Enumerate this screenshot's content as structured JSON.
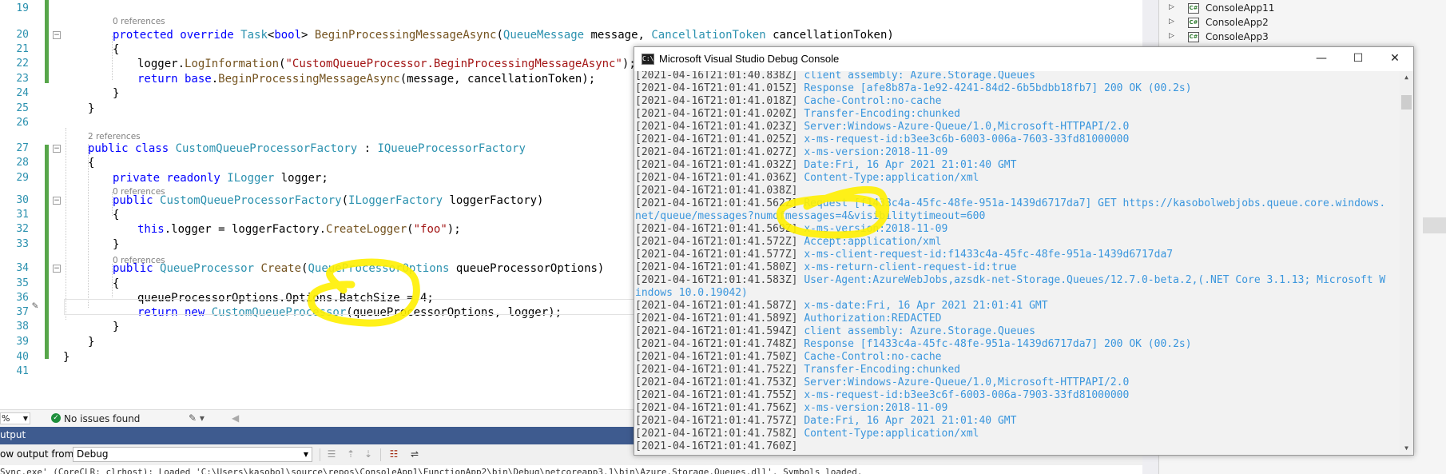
{
  "editor": {
    "code_lines": [
      {
        "num": "19",
        "parts": []
      },
      {
        "num": "20",
        "ref": "0 references",
        "parts": [
          {
            "c": "kw",
            "t": "protected override "
          },
          {
            "c": "ty",
            "t": "Task"
          },
          {
            "c": "",
            "t": "<"
          },
          {
            "c": "kw",
            "t": "bool"
          },
          {
            "c": "",
            "t": "> "
          },
          {
            "c": "mt",
            "t": "BeginProcessingMessageAsync"
          },
          {
            "c": "",
            "t": "("
          },
          {
            "c": "ty",
            "t": "QueueMessage"
          },
          {
            "c": "",
            "t": " message, "
          },
          {
            "c": "ty",
            "t": "CancellationToken"
          },
          {
            "c": "",
            "t": " cancellationToken)"
          }
        ]
      },
      {
        "num": "21",
        "parts": [
          {
            "c": "",
            "t": "{"
          }
        ]
      },
      {
        "num": "22",
        "parts": [
          {
            "c": "",
            "t": "logger."
          },
          {
            "c": "mt",
            "t": "LogInformation"
          },
          {
            "c": "",
            "t": "("
          },
          {
            "c": "st",
            "t": "\"CustomQueueProcessor.BeginProcessingMessageAsync\""
          },
          {
            "c": "",
            "t": ");"
          }
        ]
      },
      {
        "num": "23",
        "parts": [
          {
            "c": "kw",
            "t": "return base"
          },
          {
            "c": "",
            "t": "."
          },
          {
            "c": "mt",
            "t": "BeginProcessingMessageAsync"
          },
          {
            "c": "",
            "t": "(message, cancellationToken);"
          }
        ]
      },
      {
        "num": "24",
        "parts": [
          {
            "c": "",
            "t": "}"
          }
        ]
      },
      {
        "num": "25",
        "parts": [
          {
            "c": "",
            "t": "}"
          }
        ]
      },
      {
        "num": "26",
        "parts": []
      },
      {
        "num": "27",
        "ref": "2 references",
        "parts": [
          {
            "c": "kw",
            "t": "public class "
          },
          {
            "c": "ty",
            "t": "CustomQueueProcessorFactory"
          },
          {
            "c": "",
            "t": " : "
          },
          {
            "c": "ty",
            "t": "IQueueProcessorFactory"
          }
        ]
      },
      {
        "num": "28",
        "parts": [
          {
            "c": "",
            "t": "{"
          }
        ]
      },
      {
        "num": "29",
        "parts": [
          {
            "c": "kw",
            "t": "private readonly "
          },
          {
            "c": "ty",
            "t": "ILogger"
          },
          {
            "c": "",
            "t": " logger;"
          }
        ]
      },
      {
        "num": "30",
        "ref": "0 references",
        "parts": [
          {
            "c": "kw",
            "t": "public "
          },
          {
            "c": "ty",
            "t": "CustomQueueProcessorFactory"
          },
          {
            "c": "",
            "t": "("
          },
          {
            "c": "ty",
            "t": "ILoggerFactory"
          },
          {
            "c": "",
            "t": " loggerFactory)"
          }
        ]
      },
      {
        "num": "31",
        "parts": [
          {
            "c": "",
            "t": "{"
          }
        ]
      },
      {
        "num": "32",
        "parts": [
          {
            "c": "kw",
            "t": "this"
          },
          {
            "c": "",
            "t": ".logger = loggerFactory."
          },
          {
            "c": "mt",
            "t": "CreateLogger"
          },
          {
            "c": "",
            "t": "("
          },
          {
            "c": "st",
            "t": "\"foo\""
          },
          {
            "c": "",
            "t": ");"
          }
        ]
      },
      {
        "num": "33",
        "parts": [
          {
            "c": "",
            "t": "}"
          }
        ]
      },
      {
        "num": "34",
        "ref": "0 references",
        "parts": [
          {
            "c": "kw",
            "t": "public "
          },
          {
            "c": "ty",
            "t": "QueueProcessor"
          },
          {
            "c": "",
            "t": " "
          },
          {
            "c": "mt",
            "t": "Create"
          },
          {
            "c": "",
            "t": "("
          },
          {
            "c": "ty",
            "t": "QueueProcessorOptions"
          },
          {
            "c": "",
            "t": " queueProcessorOptions)"
          }
        ]
      },
      {
        "num": "35",
        "parts": [
          {
            "c": "",
            "t": "{"
          }
        ]
      },
      {
        "num": "36",
        "parts": [
          {
            "c": "",
            "t": "queueProcessorOptions.Options.BatchSize = 4;"
          }
        ]
      },
      {
        "num": "37",
        "parts": [
          {
            "c": "kw",
            "t": "return new "
          },
          {
            "c": "ty",
            "t": "CustomQueueProcessor"
          },
          {
            "c": "",
            "t": "(queueProcessorOptions, logger);"
          }
        ]
      },
      {
        "num": "38",
        "parts": [
          {
            "c": "",
            "t": "}"
          }
        ]
      },
      {
        "num": "39",
        "parts": [
          {
            "c": "",
            "t": "}"
          }
        ]
      },
      {
        "num": "40",
        "parts": [
          {
            "c": "",
            "t": "}"
          }
        ]
      },
      {
        "num": "41",
        "parts": []
      }
    ]
  },
  "status": {
    "zoom": "%",
    "issues": "No issues found"
  },
  "output": {
    "title": "utput",
    "show_from_label": "ow output from:",
    "source": "Debug",
    "text": "Sync.exe' (CoreCLR: clrhost): Loaded 'C:\\Users\\kasobol\\source\\repos\\ConsoleApp1\\FunctionApp2\\bin\\Debug\\netcoreapp3.1\\bin\\Azure.Storage.Queues.dll'. Symbols loaded."
  },
  "solution_explorer": {
    "items": [
      "ConsoleApp11",
      "ConsoleApp2",
      "ConsoleApp3"
    ]
  },
  "console": {
    "title": "Microsoft Visual Studio Debug Console",
    "icon_text": "C:\\",
    "lines": [
      {
        "ts": "[2021-04-16T21:01:40.838Z]",
        "msg": " client assembly: Azure.Storage.Queues"
      },
      {
        "ts": "[2021-04-16T21:01:41.015Z]",
        "msg": " Response [afe8b87a-1e92-4241-84d2-6b5bdbb18fb7] 200 OK (00.2s)"
      },
      {
        "ts": "[2021-04-16T21:01:41.018Z]",
        "msg": " Cache-Control:no-cache"
      },
      {
        "ts": "[2021-04-16T21:01:41.020Z]",
        "msg": " Transfer-Encoding:chunked"
      },
      {
        "ts": "[2021-04-16T21:01:41.023Z]",
        "msg": " Server:Windows-Azure-Queue/1.0,Microsoft-HTTPAPI/2.0"
      },
      {
        "ts": "[2021-04-16T21:01:41.025Z]",
        "msg": " x-ms-request-id:b3ee3c6b-6003-006a-7603-33fd81000000"
      },
      {
        "ts": "[2021-04-16T21:01:41.027Z]",
        "msg": " x-ms-version:2018-11-09"
      },
      {
        "ts": "[2021-04-16T21:01:41.032Z]",
        "msg": " Date:Fri, 16 Apr 2021 21:01:40 GMT"
      },
      {
        "ts": "[2021-04-16T21:01:41.036Z]",
        "msg": " Content-Type:application/xml"
      },
      {
        "ts": "[2021-04-16T21:01:41.038Z]",
        "msg": ""
      },
      {
        "ts": "[2021-04-16T21:01:41.562Z]",
        "msg": " Request [f1433c4a-45fc-48fe-951a-1439d6717da7] GET https://kasobolwebjobs.queue.core.windows."
      },
      {
        "ts": "",
        "msg": "net/queue/messages?numofmessages=4&visibilitytimeout=600"
      },
      {
        "ts": "[2021-04-16T21:01:41.569Z]",
        "msg": " x-ms-version:2018-11-09"
      },
      {
        "ts": "[2021-04-16T21:01:41.572Z]",
        "msg": " Accept:application/xml"
      },
      {
        "ts": "[2021-04-16T21:01:41.577Z]",
        "msg": " x-ms-client-request-id:f1433c4a-45fc-48fe-951a-1439d6717da7"
      },
      {
        "ts": "[2021-04-16T21:01:41.580Z]",
        "msg": " x-ms-return-client-request-id:true"
      },
      {
        "ts": "[2021-04-16T21:01:41.583Z]",
        "msg": " User-Agent:AzureWebJobs,azsdk-net-Storage.Queues/12.7.0-beta.2,(.NET Core 3.1.13; Microsoft W"
      },
      {
        "ts": "",
        "msg": "indows 10.0.19042)"
      },
      {
        "ts": "[2021-04-16T21:01:41.587Z]",
        "msg": " x-ms-date:Fri, 16 Apr 2021 21:01:41 GMT"
      },
      {
        "ts": "[2021-04-16T21:01:41.589Z]",
        "msg": " Authorization:REDACTED"
      },
      {
        "ts": "[2021-04-16T21:01:41.594Z]",
        "msg": " client assembly: Azure.Storage.Queues"
      },
      {
        "ts": "[2021-04-16T21:01:41.748Z]",
        "msg": " Response [f1433c4a-45fc-48fe-951a-1439d6717da7] 200 OK (00.2s)"
      },
      {
        "ts": "[2021-04-16T21:01:41.750Z]",
        "msg": " Cache-Control:no-cache"
      },
      {
        "ts": "[2021-04-16T21:01:41.752Z]",
        "msg": " Transfer-Encoding:chunked"
      },
      {
        "ts": "[2021-04-16T21:01:41.753Z]",
        "msg": " Server:Windows-Azure-Queue/1.0,Microsoft-HTTPAPI/2.0"
      },
      {
        "ts": "[2021-04-16T21:01:41.755Z]",
        "msg": " x-ms-request-id:b3ee3c6f-6003-006a-7903-33fd81000000"
      },
      {
        "ts": "[2021-04-16T21:01:41.756Z]",
        "msg": " x-ms-version:2018-11-09"
      },
      {
        "ts": "[2021-04-16T21:01:41.757Z]",
        "msg": " Date:Fri, 16 Apr 2021 21:01:40 GMT"
      },
      {
        "ts": "[2021-04-16T21:01:41.758Z]",
        "msg": " Content-Type:application/xml"
      },
      {
        "ts": "[2021-04-16T21:01:41.760Z]",
        "msg": ""
      }
    ]
  },
  "colors": {
    "annotation": "#ffef00",
    "console_text": "#3a96dd",
    "output_header": "#3e5b8f"
  }
}
